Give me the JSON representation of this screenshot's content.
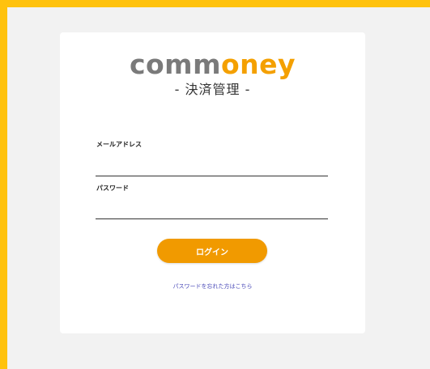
{
  "brand": {
    "logo_part1": "comm",
    "logo_part2": "oney",
    "subtitle": "- 決済管理 -"
  },
  "form": {
    "email_label": "メールアドレス",
    "email_value": "",
    "password_label": "パスワード",
    "password_value": "",
    "login_label": "ログイン",
    "forgot_label": "パスワードを忘れた方はこちら"
  },
  "colors": {
    "frame": "#ffc20e",
    "background": "#f2f2f2",
    "logo_gray": "#7a7a7a",
    "logo_orange": "#f4a000",
    "button": "#f19a00",
    "link": "#4a4ab8"
  }
}
